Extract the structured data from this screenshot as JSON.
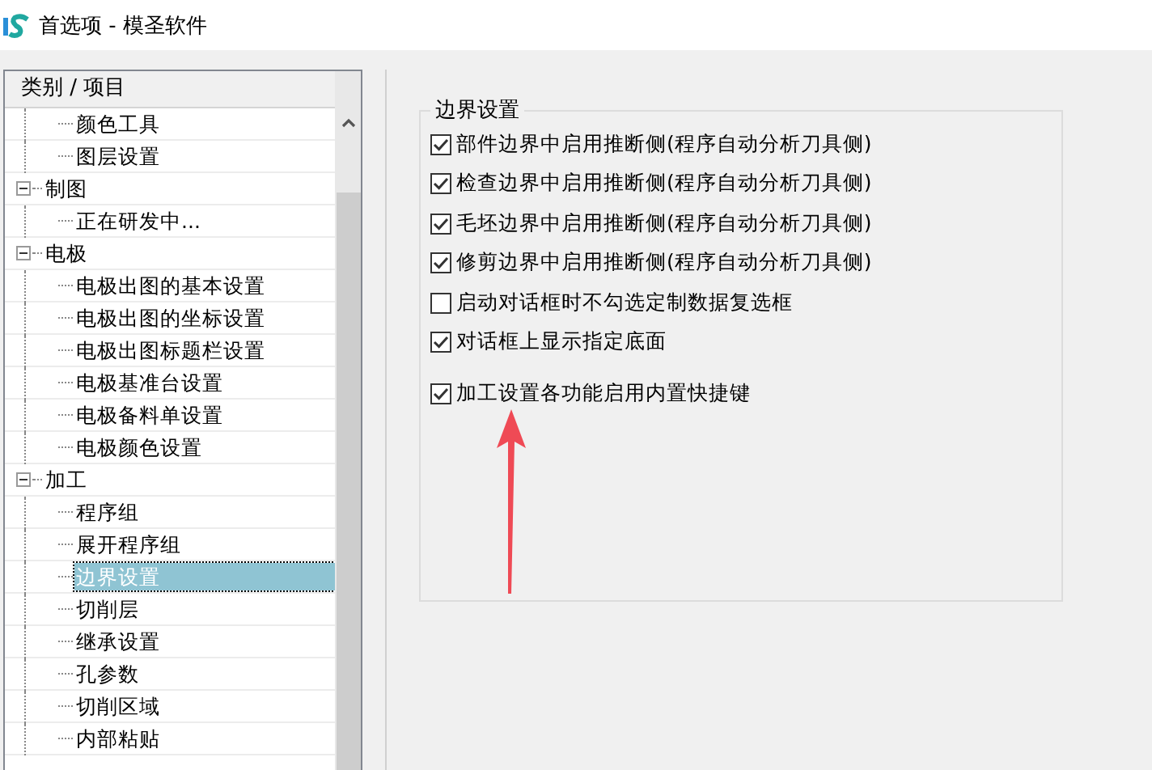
{
  "window": {
    "title": "首选项 - 模圣软件"
  },
  "tree": {
    "header": "类别 / 项目",
    "nodes": [
      {
        "children": [
          {
            "label": "颜色工具",
            "selected": false
          },
          {
            "label": "图层设置",
            "selected": false
          }
        ]
      },
      {
        "label": "制图",
        "expanded": true,
        "children": [
          {
            "label": "正在研发中...",
            "selected": false
          }
        ]
      },
      {
        "label": "电极",
        "expanded": true,
        "children": [
          {
            "label": "电极出图的基本设置",
            "selected": false
          },
          {
            "label": "电极出图的坐标设置",
            "selected": false
          },
          {
            "label": "电极出图标题栏设置",
            "selected": false
          },
          {
            "label": "电极基准台设置",
            "selected": false
          },
          {
            "label": "电极备料单设置",
            "selected": false
          },
          {
            "label": "电极颜色设置",
            "selected": false
          }
        ]
      },
      {
        "label": "加工",
        "expanded": true,
        "children": [
          {
            "label": "程序组",
            "selected": false
          },
          {
            "label": "展开程序组",
            "selected": false
          },
          {
            "label": "边界设置",
            "selected": true
          },
          {
            "label": "切削层",
            "selected": false
          },
          {
            "label": "继承设置",
            "selected": false
          },
          {
            "label": "孔参数",
            "selected": false
          },
          {
            "label": "切削区域",
            "selected": false
          },
          {
            "label": "内部粘贴",
            "selected": false
          }
        ]
      }
    ]
  },
  "group": {
    "title": "边界设置",
    "options": [
      {
        "label": "部件边界中启用推断侧(程序自动分析刀具侧)",
        "checked": true
      },
      {
        "label": "检查边界中启用推断侧(程序自动分析刀具侧)",
        "checked": true
      },
      {
        "label": "毛坯边界中启用推断侧(程序自动分析刀具侧)",
        "checked": true
      },
      {
        "label": "修剪边界中启用推断侧(程序自动分析刀具侧)",
        "checked": true
      },
      {
        "label": "启动对话框时不勾选定制数据复选框",
        "checked": false
      },
      {
        "label": "对话框上显示指定底面",
        "checked": true
      },
      {
        "label": "加工设置各功能启用内置快捷键",
        "checked": true
      }
    ]
  }
}
